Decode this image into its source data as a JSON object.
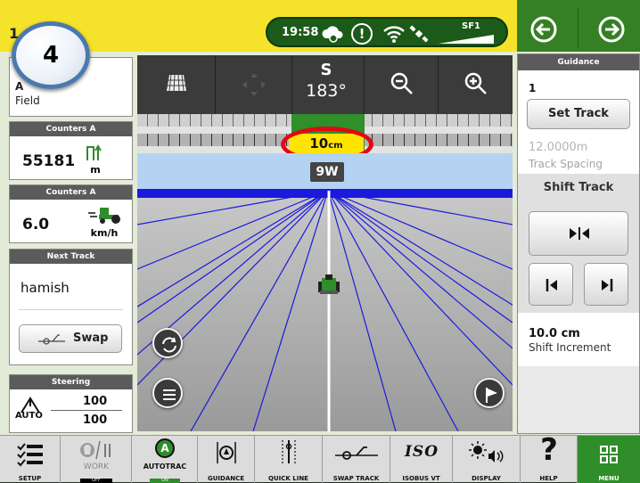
{
  "topbar": {
    "run_number": "1",
    "time": "19:58",
    "alert_symbol": "!",
    "gps_label": "SF1"
  },
  "badge": {
    "number": "4"
  },
  "left_panel": {
    "field_widget": {
      "line1": "A",
      "line2": "Field"
    },
    "counter1": {
      "title": "Counters A",
      "value": "55181",
      "unit": "m"
    },
    "counter2": {
      "title": "Counters A",
      "value": "6.0",
      "unit": "km/h"
    },
    "next_track": {
      "title": "Next Track",
      "name": "hamish",
      "swap_label": "Swap"
    },
    "steering": {
      "title": "Steering",
      "mode": "AUTO",
      "value_top": "100",
      "value_bottom": "100"
    }
  },
  "guidance_view": {
    "heading_letter": "S",
    "heading_degrees": "183°",
    "deviation_value": "10",
    "deviation_unit": "cm",
    "track_label": "9W"
  },
  "right_panel": {
    "title": "Guidance",
    "track_number": "1",
    "set_track_label": "Set Track",
    "track_spacing_value": "12.0000m",
    "track_spacing_label": "Track Spacing",
    "shift_track_title": "Shift Track",
    "shift_increment_value": "10.0 cm",
    "shift_increment_label": "Shift Increment"
  },
  "bottom_bar": {
    "setup": "SETUP",
    "work": "WORK",
    "work_status": "OFF",
    "autotrac": "AUTOTRAC",
    "autotrac_status": "ON",
    "autotrac_badge": "A",
    "guidance": "GUIDANCE",
    "quick_line": "QUICK LINE",
    "swap_track": "SWAP TRACK",
    "isobus_vt": "ISOBUS VT",
    "isobus_logo": "ISO",
    "display": "DISPLAY",
    "help": "HELP",
    "help_symbol": "?",
    "menu": "MENU"
  },
  "colors": {
    "topbar_yellow": "#f5e22a",
    "jd_green": "#357f25",
    "deviation_yellow": "#ffe400",
    "highlight_red": "#e30613",
    "guidance_line_blue": "#1a1adc"
  }
}
